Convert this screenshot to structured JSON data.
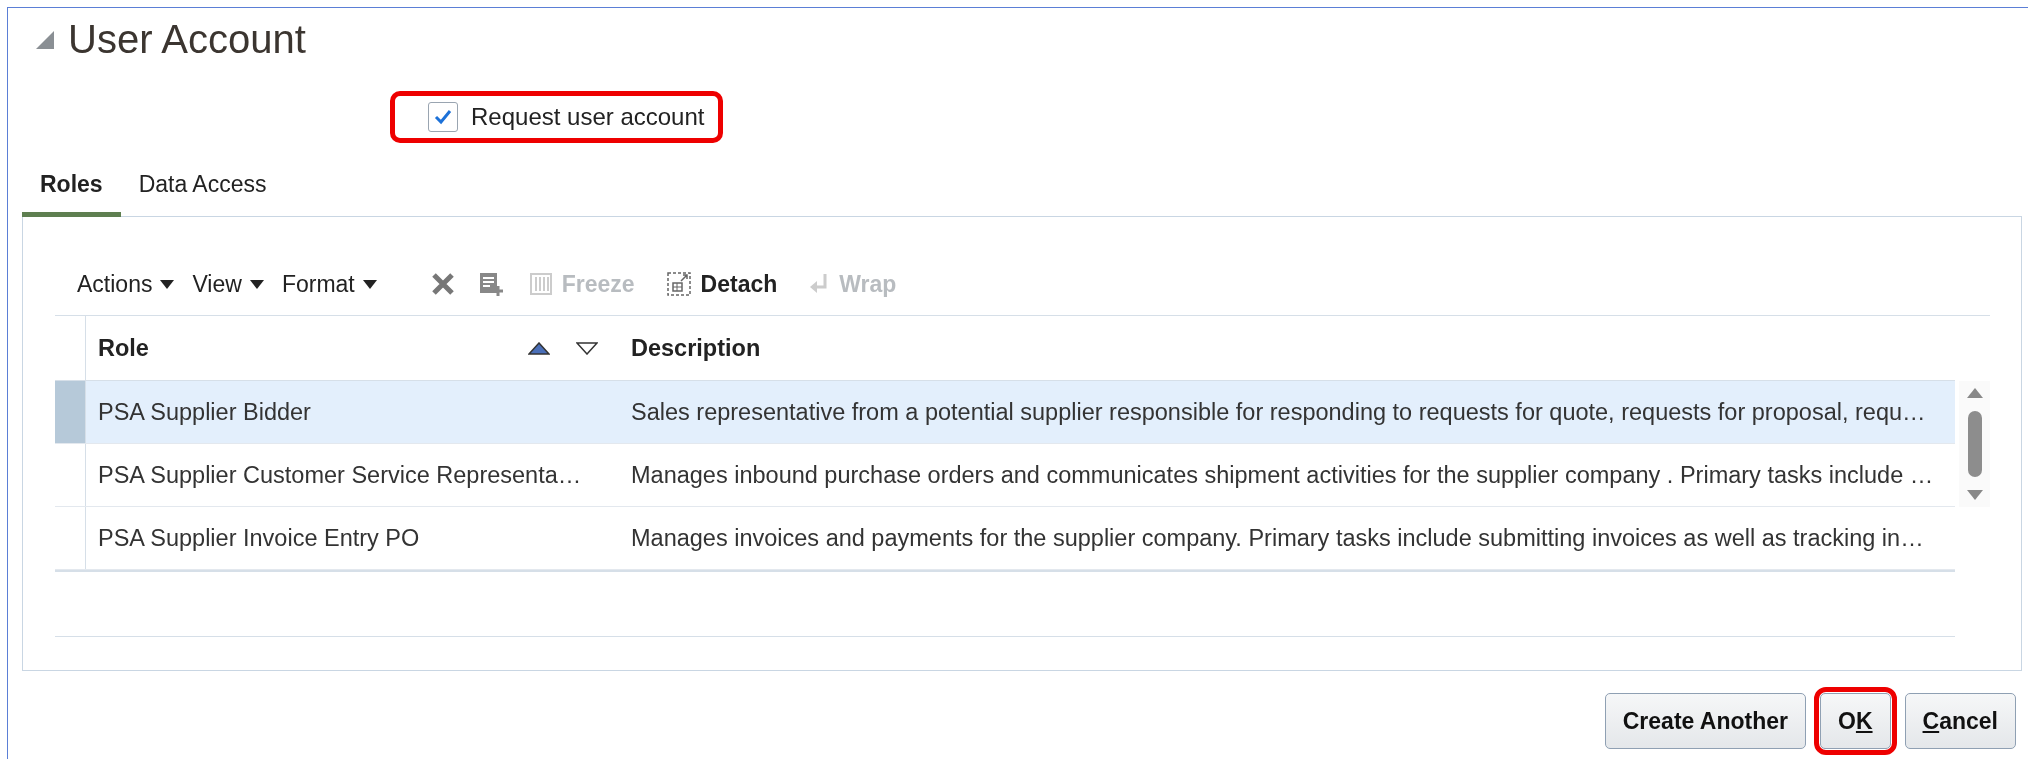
{
  "section": {
    "title": "User Account",
    "expanded": true
  },
  "request_account": {
    "label": "Request user account",
    "checked": true,
    "highlighted": true
  },
  "tabs": [
    {
      "label": "Roles",
      "selected": true
    },
    {
      "label": "Data Access",
      "selected": false
    }
  ],
  "toolbar": [
    {
      "kind": "menu",
      "label": "Actions",
      "disabled": false
    },
    {
      "kind": "menu",
      "label": "View",
      "disabled": false
    },
    {
      "kind": "menu",
      "label": "Format",
      "disabled": false
    },
    {
      "kind": "delete"
    },
    {
      "kind": "add"
    },
    {
      "kind": "freeze",
      "label": "Freeze",
      "disabled": true
    },
    {
      "kind": "detach",
      "label": "Detach",
      "disabled": false
    },
    {
      "kind": "wrap",
      "label": "Wrap",
      "disabled": true
    }
  ],
  "table": {
    "columns": [
      {
        "label": "Role",
        "sort_ascending": true,
        "sort_descending": false
      },
      {
        "label": "Description"
      }
    ],
    "rows": [
      {
        "selected": true,
        "cells": [
          "PSA Supplier Bidder",
          "Sales representative from a potential supplier responsible for responding to requests for quote, requests for proposal, requ…"
        ]
      },
      {
        "selected": false,
        "cells": [
          "PSA Supplier Customer Service Representa…",
          "Manages inbound purchase orders and communicates shipment activities for the supplier company . Primary tasks include …"
        ]
      },
      {
        "selected": false,
        "cells": [
          "PSA Supplier Invoice Entry PO",
          "Manages invoices and payments for the supplier company. Primary tasks include submitting invoices as well as tracking in…"
        ]
      }
    ]
  },
  "buttons": [
    {
      "label_parts": [
        {
          "text": "Create Another",
          "underlined": false
        }
      ],
      "highlighted": false
    },
    {
      "label_parts": [
        {
          "text": "O",
          "underlined": false
        },
        {
          "text": "K",
          "underlined": true
        }
      ],
      "highlighted": true
    },
    {
      "label_parts": [
        {
          "text": "C",
          "underlined": true
        },
        {
          "text": "ancel",
          "underlined": false
        }
      ],
      "highlighted": false
    }
  ]
}
